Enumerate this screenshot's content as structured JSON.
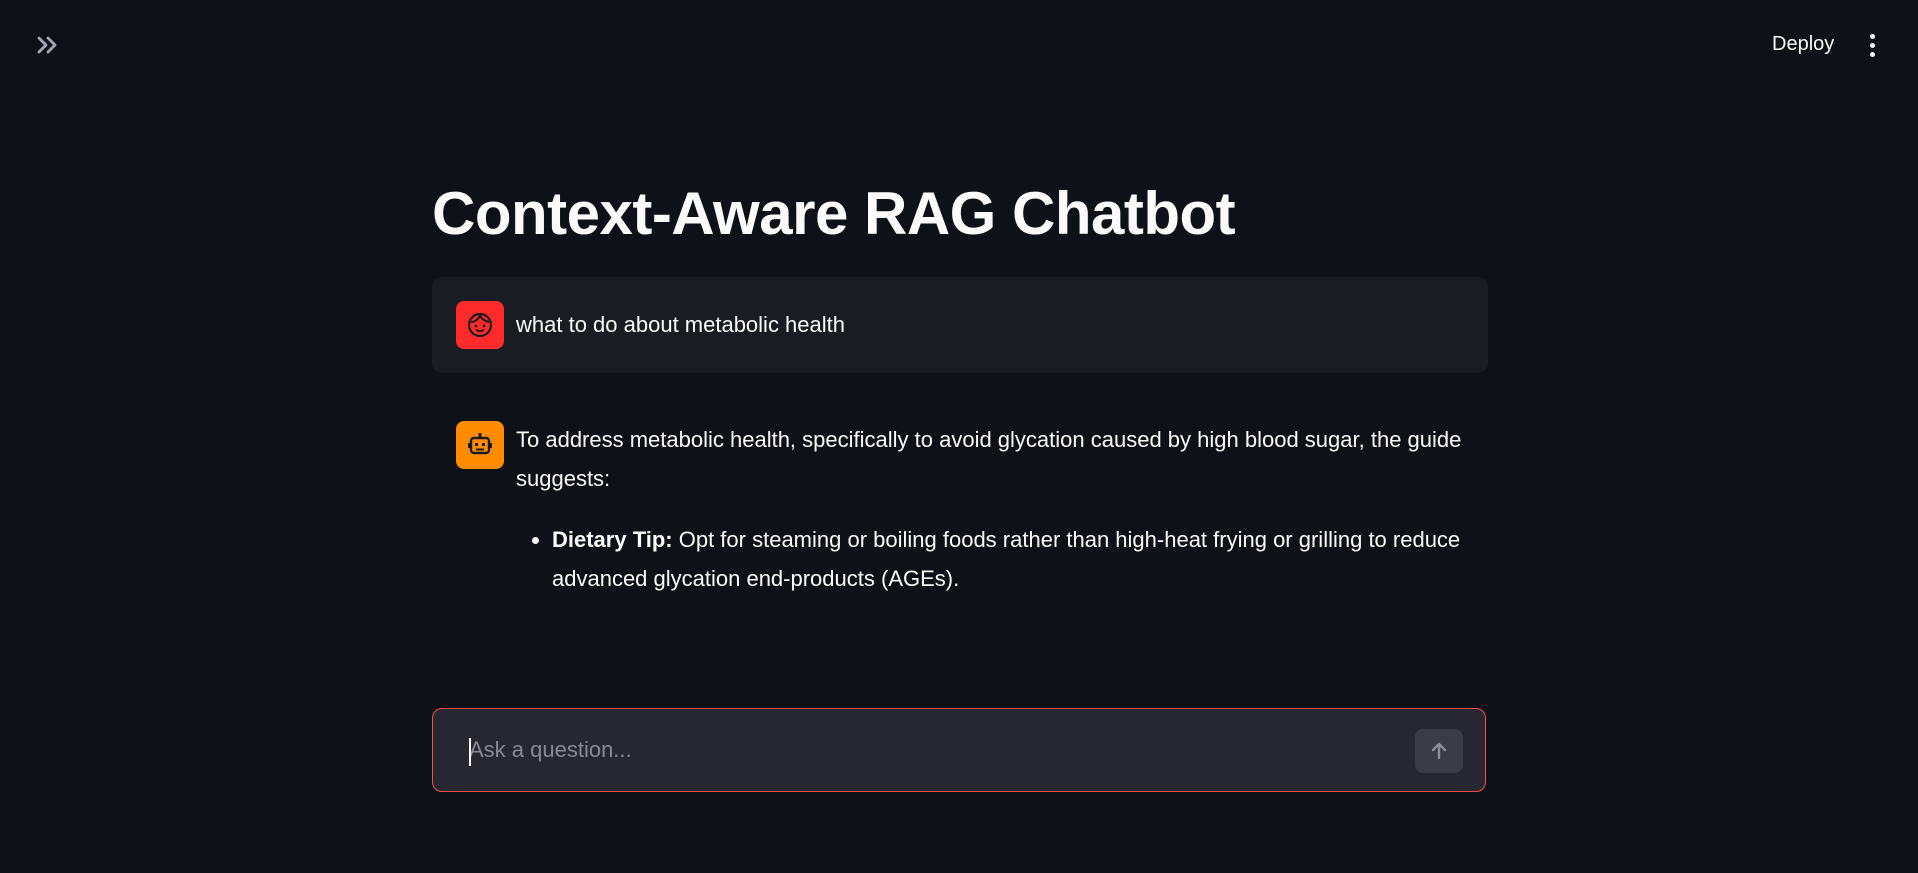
{
  "header": {
    "sidebar_toggle_icon": "double-chevron-right-icon",
    "deploy_label": "Deploy",
    "menu_icon": "vertical-ellipsis-icon"
  },
  "page": {
    "title": "Context-Aware RAG Chatbot"
  },
  "messages": [
    {
      "role": "user",
      "avatar_icon": "user-face-icon",
      "avatar_color": "#ff2b2b",
      "text": "what to do about metabolic health"
    },
    {
      "role": "assistant",
      "avatar_icon": "robot-icon",
      "avatar_color": "#ff8c00",
      "intro": "To address metabolic health, specifically to avoid glycation caused by high blood sugar, the guide suggests:",
      "bullets": [
        {
          "label": "Dietary Tip:",
          "text": " Opt for steaming or boiling foods rather than high-heat frying or grilling to reduce advanced glycation end-products (AGEs)."
        }
      ]
    }
  ],
  "chat_input": {
    "placeholder": "Ask a question...",
    "value": "",
    "send_icon": "arrow-up-icon",
    "border_color": "#ff4b4b"
  },
  "theme": {
    "background": "#0e1117",
    "text": "#fafafa"
  }
}
